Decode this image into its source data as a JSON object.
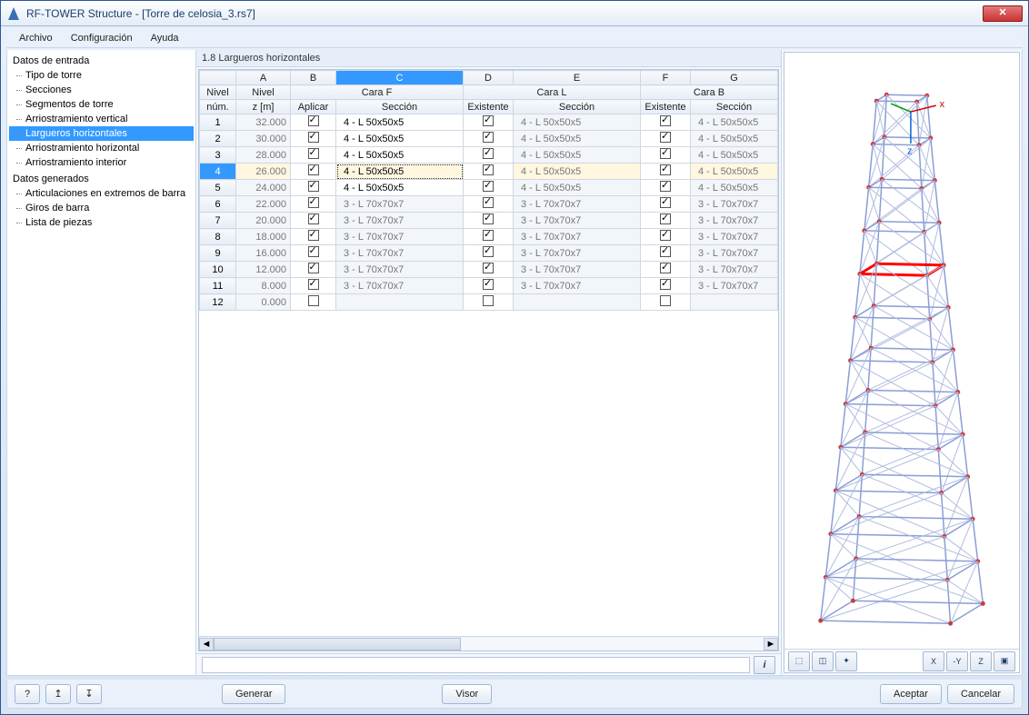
{
  "window": {
    "title": "RF-TOWER Structure - [Torre de celosia_3.rs7]"
  },
  "menu": [
    "Archivo",
    "Configuración",
    "Ayuda"
  ],
  "tree": {
    "groups": [
      {
        "label": "Datos de entrada",
        "items": [
          "Tipo de torre",
          "Secciones",
          "Segmentos de torre",
          "Arriostramiento vertical",
          "Largueros horizontales",
          "Arriostramiento horizontal",
          "Arriostramiento interior"
        ],
        "sel": 4
      },
      {
        "label": "Datos generados",
        "items": [
          "Articulaciones en extremos de barra",
          "Giros de barra",
          "Lista de piezas"
        ],
        "sel": -1
      }
    ]
  },
  "section_title": "1.8 Largueros horizontales",
  "table": {
    "col_letters": [
      "A",
      "B",
      "C",
      "D",
      "E",
      "F",
      "G"
    ],
    "head1": {
      "nivel": "Nivel",
      "a": "Nivel",
      "bc": "Cara F",
      "de": "Cara L",
      "fg": "Cara B"
    },
    "head2": {
      "num": "núm.",
      "z": "z [m]",
      "aplicar": "Aplicar",
      "seccion": "Sección",
      "existente": "Existente",
      "seccion2": "Sección",
      "existente2": "Existente",
      "seccion3": "Sección"
    },
    "selected_col_letter": "C",
    "selected_row": 4,
    "rows": [
      {
        "n": 1,
        "z": "32.000",
        "ap": true,
        "sF": "4 - L 50x50x5",
        "eL": true,
        "sL": "4 - L 50x50x5",
        "eB": true,
        "sB": "4 - L 50x50x5"
      },
      {
        "n": 2,
        "z": "30.000",
        "ap": true,
        "sF": "4 - L 50x50x5",
        "eL": true,
        "sL": "4 - L 50x50x5",
        "eB": true,
        "sB": "4 - L 50x50x5"
      },
      {
        "n": 3,
        "z": "28.000",
        "ap": true,
        "sF": "4 - L 50x50x5",
        "eL": true,
        "sL": "4 - L 50x50x5",
        "eB": true,
        "sB": "4 - L 50x50x5"
      },
      {
        "n": 4,
        "z": "26.000",
        "ap": true,
        "sF": "4 - L 50x50x5",
        "eL": true,
        "sL": "4 - L 50x50x5",
        "eB": true,
        "sB": "4 - L 50x50x5"
      },
      {
        "n": 5,
        "z": "24.000",
        "ap": true,
        "sF": "4 - L 50x50x5",
        "eL": true,
        "sL": "4 - L 50x50x5",
        "eB": true,
        "sB": "4 - L 50x50x5"
      },
      {
        "n": 6,
        "z": "22.000",
        "ap": true,
        "sF": "3 - L 70x70x7",
        "eL": true,
        "sL": "3 - L 70x70x7",
        "eB": true,
        "sB": "3 - L 70x70x7"
      },
      {
        "n": 7,
        "z": "20.000",
        "ap": true,
        "sF": "3 - L 70x70x7",
        "eL": true,
        "sL": "3 - L 70x70x7",
        "eB": true,
        "sB": "3 - L 70x70x7"
      },
      {
        "n": 8,
        "z": "18.000",
        "ap": true,
        "sF": "3 - L 70x70x7",
        "eL": true,
        "sL": "3 - L 70x70x7",
        "eB": true,
        "sB": "3 - L 70x70x7"
      },
      {
        "n": 9,
        "z": "16.000",
        "ap": true,
        "sF": "3 - L 70x70x7",
        "eL": true,
        "sL": "3 - L 70x70x7",
        "eB": true,
        "sB": "3 - L 70x70x7"
      },
      {
        "n": 10,
        "z": "12.000",
        "ap": true,
        "sF": "3 - L 70x70x7",
        "eL": true,
        "sL": "3 - L 70x70x7",
        "eB": true,
        "sB": "3 - L 70x70x7"
      },
      {
        "n": 11,
        "z": "8.000",
        "ap": true,
        "sF": "3 - L 70x70x7",
        "eL": true,
        "sL": "3 - L 70x70x7",
        "eB": true,
        "sB": "3 - L 70x70x7"
      },
      {
        "n": 12,
        "z": "0.000",
        "ap": false,
        "sF": "",
        "eL": false,
        "sL": "",
        "eB": false,
        "sB": ""
      }
    ]
  },
  "preview_tools": {
    "left": [
      "view-mode-1-icon",
      "view-mode-2-icon",
      "view-mode-3-icon"
    ],
    "right": [
      "axis-x-icon",
      "axis-y-icon",
      "axis-z-icon",
      "iso-icon"
    ]
  },
  "footer": {
    "help": "?",
    "nav_up": "↥",
    "nav_down": "↧",
    "generar": "Generar",
    "visor": "Visor",
    "aceptar": "Aceptar",
    "cancelar": "Cancelar"
  },
  "axes": {
    "x": "x",
    "z": "z"
  }
}
